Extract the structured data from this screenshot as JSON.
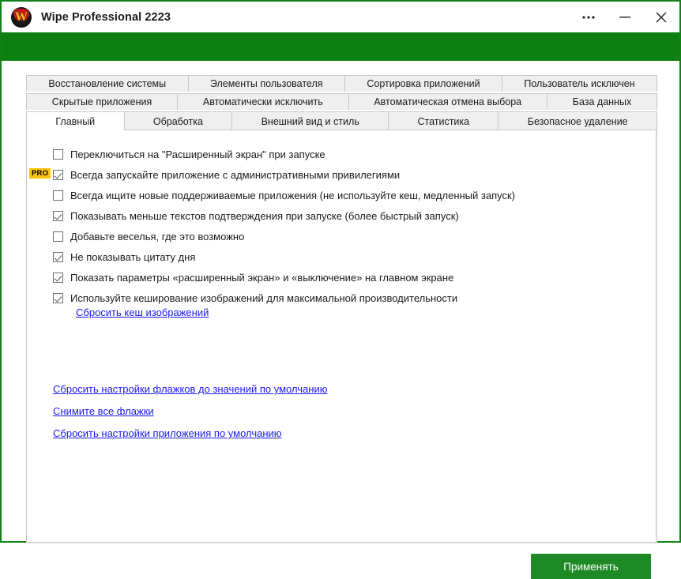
{
  "window": {
    "title": "Wipe Professional 2223",
    "logo_icon": "wipe-logo-icon",
    "accent_color": "#0e8013",
    "border_color": "#138017",
    "controls": {
      "more_label": "•••",
      "more_icon": "ellipsis-icon",
      "minimize_icon": "minimize-icon",
      "close_icon": "close-icon"
    }
  },
  "tabs": {
    "row1": [
      {
        "label": "Восстановление системы",
        "active": false
      },
      {
        "label": "Элементы пользователя",
        "active": false
      },
      {
        "label": "Сортировка приложений",
        "active": false
      },
      {
        "label": "Пользователь исключен",
        "active": false
      }
    ],
    "row2": [
      {
        "label": "Скрытые приложения",
        "active": false
      },
      {
        "label": "Автоматически исключить",
        "active": false
      },
      {
        "label": "Автоматическая отмена выбора",
        "active": false
      },
      {
        "label": "База данных",
        "active": false
      }
    ],
    "row3": [
      {
        "label": "Главный",
        "active": true
      },
      {
        "label": "Обработка",
        "active": false
      },
      {
        "label": "Внешний вид и стиль",
        "active": false
      },
      {
        "label": "Статистика",
        "active": false
      },
      {
        "label": "Безопасное удаление",
        "active": false
      }
    ]
  },
  "options": [
    {
      "label": "Переключиться на \"Расширенный экран\" при запуске",
      "checked": false,
      "pro": false
    },
    {
      "label": "Всегда запускайте приложение с административными привилегиями",
      "checked": true,
      "pro": true,
      "pro_label": "PRO"
    },
    {
      "label": "Всегда ищите новые поддерживаемые приложения (не используйте кеш, медленный запуск)",
      "checked": false,
      "pro": false
    },
    {
      "label": "Показывать меньше текстов подтверждения при запуске (более быстрый запуск)",
      "checked": true,
      "pro": false
    },
    {
      "label": "Добавьте веселья, где это возможно",
      "checked": false,
      "pro": false
    },
    {
      "label": "Не показывать цитату дня",
      "checked": true,
      "pro": false
    },
    {
      "label": "Показать параметры «расширенный экран» и «выключение» на главном экране",
      "checked": true,
      "pro": false
    },
    {
      "label": "Используйте кеширование изображений для максимальной производительности",
      "checked": true,
      "pro": false
    }
  ],
  "cache_link": "Сбросить кеш изображений",
  "bottom_links": [
    "Сбросить настройки флажков до значений по умолчанию",
    "Снимите все флажки",
    "Сбросить настройки приложения по умолчанию"
  ],
  "apply_button": {
    "label": "Применять",
    "color": "#1f8a25"
  }
}
